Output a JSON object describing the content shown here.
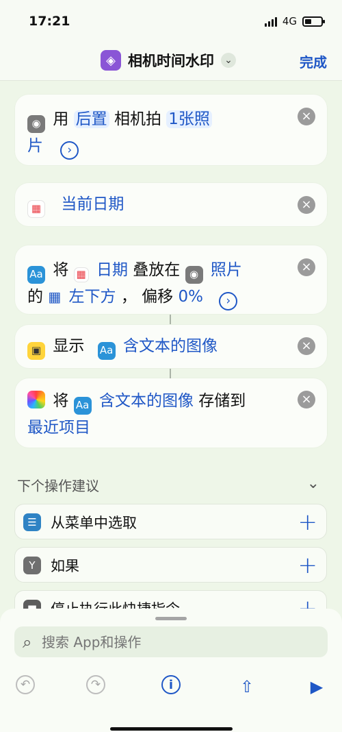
{
  "status": {
    "time": "17:21",
    "network": "4G"
  },
  "header": {
    "title": "相机时间水印",
    "done": "完成"
  },
  "actions": [
    {
      "line1a": "用",
      "token1": "后置",
      "line1b": "相机拍",
      "token2": "1张照",
      "line2a": "片"
    },
    {
      "label": "当前日期"
    },
    {
      "prefix": "将",
      "token1": "日期",
      "middle": "叠放在",
      "token2": "照片",
      "line2prefix": "的",
      "token3": "左下方",
      "comma": "，",
      "offset_label": "偏移",
      "token4": "0%"
    },
    {
      "prefix": "显示",
      "token": "含文本的图像"
    },
    {
      "prefix": "将",
      "token": "含文本的图像",
      "middle": "存储到",
      "token2": "最近项目"
    }
  ],
  "suggestions": {
    "title": "下个操作建议",
    "items": [
      {
        "label": "从菜单中选取"
      },
      {
        "label": "如果"
      },
      {
        "label": "停止执行此快捷指令"
      }
    ]
  },
  "search": {
    "placeholder": "搜索 App和操作"
  },
  "icons": {
    "accent": "#1f57c6",
    "shortcut_color": "#8a55d6"
  }
}
